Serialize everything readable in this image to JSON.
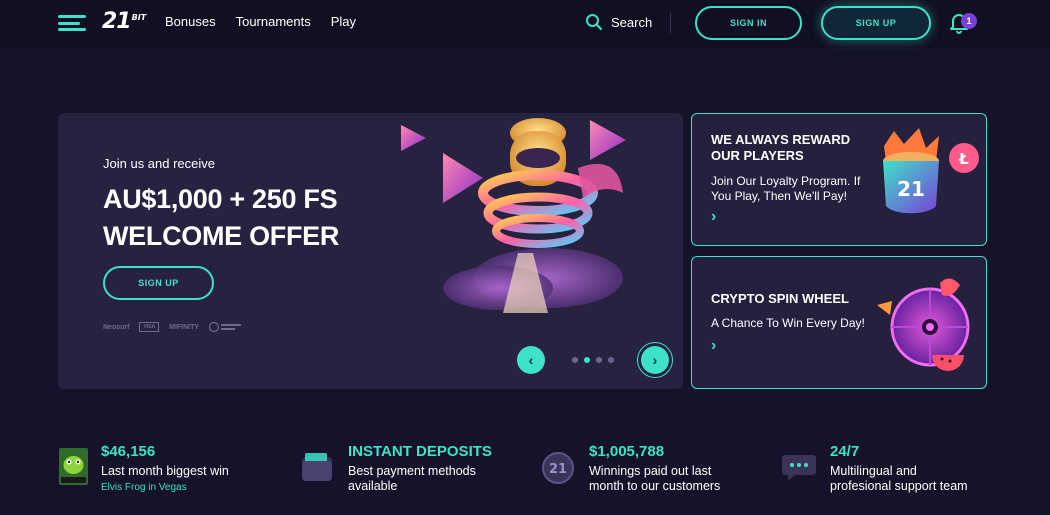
{
  "header": {
    "logo": "21",
    "logo_suffix": "BIT",
    "nav": [
      "Bonuses",
      "Tournaments",
      "Play"
    ],
    "search_label": "Search",
    "sign_in": "SIGN IN",
    "sign_up": "SIGN UP",
    "notification_count": "1"
  },
  "hero": {
    "subtitle": "Join us and receive",
    "title_line1": "AU$1,000 + 250 FS",
    "title_line2": "WELCOME OFFER",
    "cta": "SIGN UP",
    "payments": [
      "Neosurf",
      "VISA",
      "MIFINITY"
    ],
    "slider": {
      "total_slides": 4,
      "active_slide": 2
    }
  },
  "cards": [
    {
      "title_line1": "WE ALWAYS REWARD",
      "title_line2": "OUR PLAYERS",
      "text_line1": "Join Our Loyalty Program. If",
      "text_line2": "You Play, Then We'll Pay!"
    },
    {
      "title_line1": "CRYPTO SPIN WHEEL",
      "text_line1": "A Chance To Win Every Day!"
    }
  ],
  "stats": [
    {
      "head": "$46,156",
      "line1": "Last month biggest win",
      "sub": "Elvis Frog in Vegas"
    },
    {
      "head": "INSTANT DEPOSITS",
      "line1": "Best payment methods",
      "line2": "available"
    },
    {
      "head": "$1,005,788",
      "line1": "Winnings paid out last",
      "line2": "month to our customers"
    },
    {
      "head": "24/7",
      "line1": "Multilingual and",
      "line2": "profesional support team"
    }
  ],
  "colors": {
    "accent": "#3de2c8",
    "background": "#15122a",
    "card": "#24203e",
    "badge": "#7a3fd6"
  }
}
